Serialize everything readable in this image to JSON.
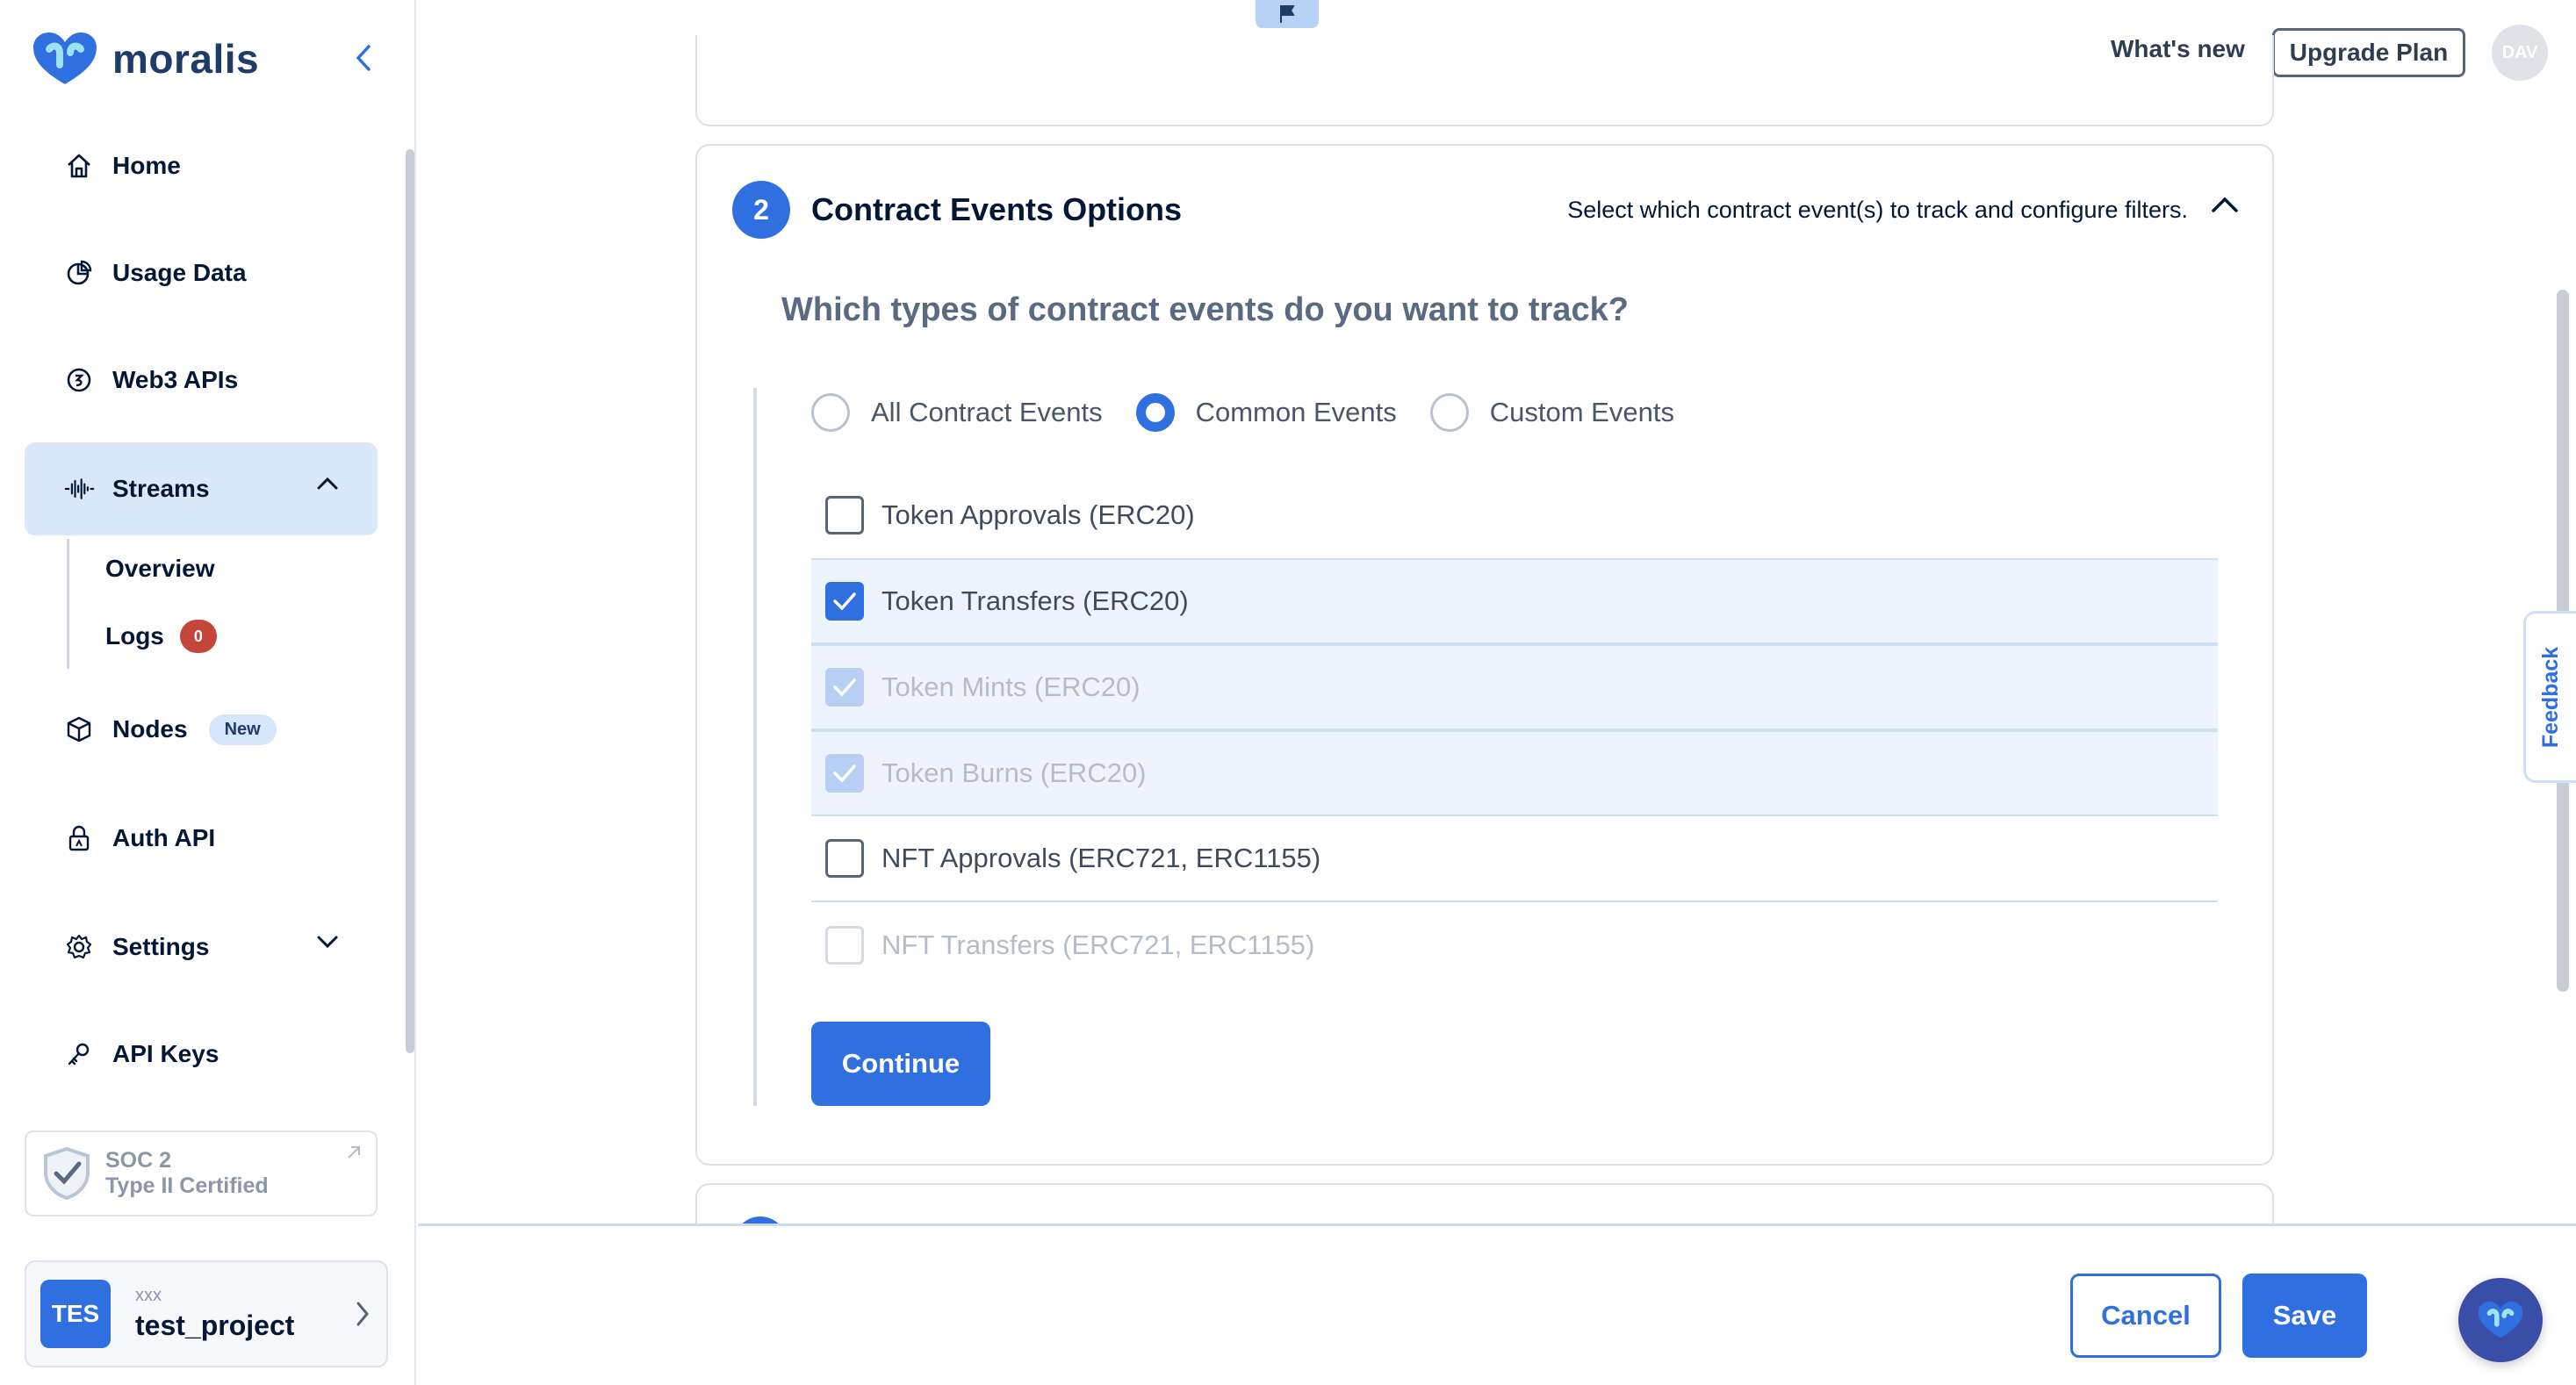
{
  "brand": {
    "name": "moralis",
    "logo_color": "#2f6fe0"
  },
  "sidebar": {
    "items": [
      {
        "label": "Home",
        "icon": "home-icon"
      },
      {
        "label": "Usage Data",
        "icon": "pie-chart-icon"
      },
      {
        "label": "Web3 APIs",
        "icon": "coin-icon"
      },
      {
        "label": "Streams",
        "icon": "waveform-icon",
        "expanded": true
      },
      {
        "label": "Nodes",
        "icon": "cube-icon",
        "badge": "New"
      },
      {
        "label": "Auth API",
        "icon": "lock-icon"
      },
      {
        "label": "Settings",
        "icon": "gear-icon"
      },
      {
        "label": "API Keys",
        "icon": "key-icon"
      }
    ],
    "streams_sub": [
      {
        "label": "Overview"
      },
      {
        "label": "Logs",
        "badge": "0"
      }
    ],
    "soc": {
      "line1": "SOC 2",
      "line2": "Type II Certified"
    },
    "project": {
      "initials": "TES",
      "sub": "xxx",
      "name": "test_project"
    }
  },
  "topbar": {
    "whats_new": "What's new",
    "upgrade": "Upgrade Plan",
    "user_initials": "DAV"
  },
  "section": {
    "step": "2",
    "title": "Contract Events Options",
    "description": "Select which contract event(s) to track and configure filters.",
    "question": "Which types of contract events do you want to track?",
    "radios": [
      {
        "label": "All Contract Events",
        "checked": false
      },
      {
        "label": "Common Events",
        "checked": true
      },
      {
        "label": "Custom Events",
        "checked": false
      }
    ],
    "options": [
      {
        "label": "Token Approvals (ERC20)",
        "state": "unchecked"
      },
      {
        "label": "Token Transfers (ERC20)",
        "state": "checked"
      },
      {
        "label": "Token Mints (ERC20)",
        "state": "checked-disabled"
      },
      {
        "label": "Token Burns (ERC20)",
        "state": "checked-disabled"
      },
      {
        "label": "NFT Approvals (ERC721, ERC1155)",
        "state": "unchecked"
      },
      {
        "label": "NFT Transfers (ERC721, ERC1155)",
        "state": "disabled"
      }
    ],
    "continue": "Continue"
  },
  "footer": {
    "cancel": "Cancel",
    "save": "Save"
  },
  "feedback": "Feedback",
  "colors": {
    "accent": "#2f6fe0",
    "active_nav_bg": "#dbe8fb",
    "badge_red": "#c4463a"
  }
}
